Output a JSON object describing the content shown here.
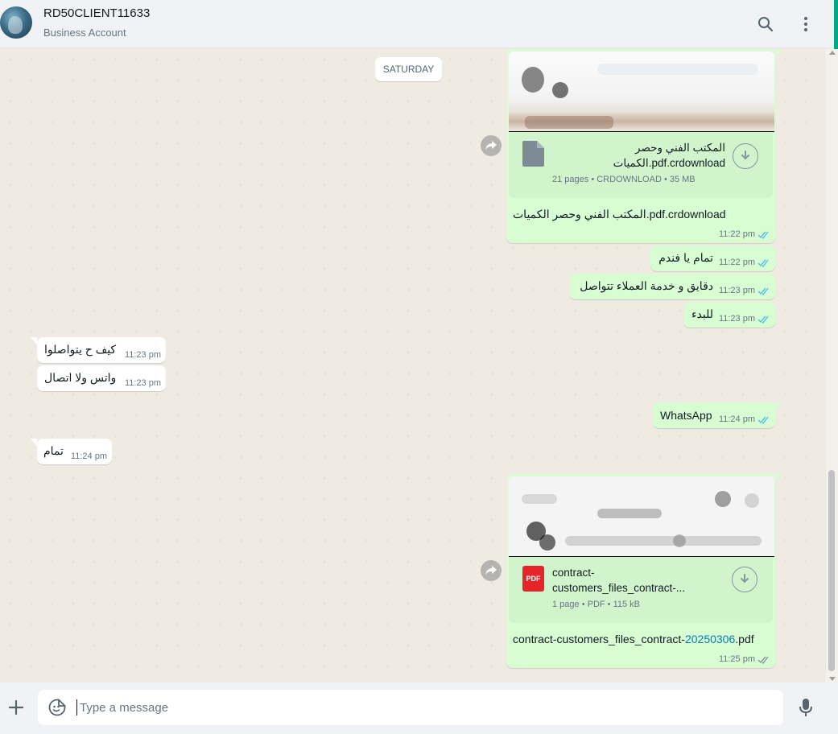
{
  "header": {
    "contact_name": "RD50CLIENT11633",
    "contact_subtitle": "Business Account",
    "icons": [
      "search-icon",
      "menu-icon"
    ]
  },
  "chat": {
    "date_label": "SATURDAY",
    "doc1": {
      "name_line1": "المكتب الفني وحصر",
      "name_line2": "الكميات.pdf.crdownload",
      "info": "21 pages • CRDOWNLOAD • 35 MB",
      "caption": "المكتب الفني وحصر الكميات.pdf.crdownload",
      "time": "11:22 pm"
    },
    "messages": [
      {
        "dir": "out",
        "text": "تمام يا فندم",
        "time": "11:22 pm"
      },
      {
        "dir": "out",
        "text": "دقايق و خدمة العملاء تتواصل",
        "time": "11:23 pm"
      },
      {
        "dir": "out",
        "text": "للبدء",
        "time": "11:23 pm"
      },
      {
        "dir": "in",
        "text": "كيف ح يتواصلوا",
        "time": "11:23 pm"
      },
      {
        "dir": "in",
        "text": "واتس ولا اتصال",
        "time": "11:23 pm"
      },
      {
        "dir": "out",
        "text": "WhatsApp",
        "time": "11:24 pm"
      },
      {
        "dir": "in",
        "text": "تمام",
        "time": "11:24 pm"
      }
    ],
    "doc2": {
      "badge": "PDF",
      "name_line1": "contract-",
      "name_line2": "customers_files_contract-...",
      "info": "1 page • PDF • 115 kB",
      "caption_prefix": "contract-customers_files_contract-",
      "caption_link": "20250306",
      "caption_suffix": ".pdf",
      "time": "11:25 pm"
    }
  },
  "composer": {
    "placeholder": "Type a message"
  },
  "colors": {
    "outgoing_bubble": "#d9fdd3",
    "incoming_bubble": "#ffffff",
    "read_ticks": "#53bdeb",
    "accent": "#00a884",
    "pdf_badge": "#e5252a"
  }
}
